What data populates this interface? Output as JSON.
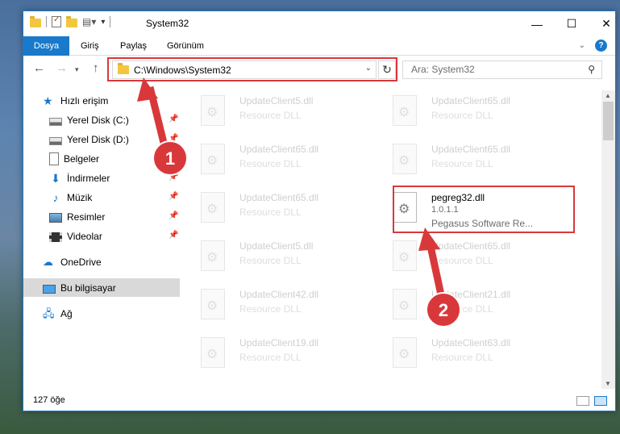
{
  "window": {
    "title": "System32"
  },
  "ribbon": {
    "tabs": [
      "Dosya",
      "Giriş",
      "Paylaş",
      "Görünüm"
    ],
    "help_label": "?"
  },
  "nav": {
    "address_path": "C:\\Windows\\System32",
    "search_placeholder": "Ara: System32"
  },
  "sidebar": {
    "items": [
      {
        "label": "Hızlı erişim",
        "icon": "star-icon"
      },
      {
        "label": "Yerel Disk (C:)",
        "icon": "drive-icon",
        "pinned": true
      },
      {
        "label": "Yerel Disk (D:)",
        "icon": "drive-icon",
        "pinned": true
      },
      {
        "label": "Belgeler",
        "icon": "document-icon",
        "pinned": true
      },
      {
        "label": "İndirmeler",
        "icon": "download-icon",
        "pinned": true
      },
      {
        "label": "Müzik",
        "icon": "music-icon",
        "pinned": true
      },
      {
        "label": "Resimler",
        "icon": "picture-icon",
        "pinned": true
      },
      {
        "label": "Videolar",
        "icon": "video-icon",
        "pinned": true
      },
      {
        "label": "OneDrive",
        "icon": "cloud-icon"
      },
      {
        "label": "Bu bilgisayar",
        "icon": "computer-icon",
        "selected": true
      },
      {
        "label": "Ağ",
        "icon": "network-icon"
      }
    ]
  },
  "files": [
    {
      "name": "UpdateClient5.dll",
      "desc": "Resource DLL"
    },
    {
      "name": "UpdateClient65.dll",
      "desc": "Resource DLL"
    },
    {
      "name": "UpdateClient65.dll",
      "desc": "Resource DLL"
    },
    {
      "name": "UpdateClient65.dll",
      "desc": "Resource DLL"
    },
    {
      "name": "UpdateClient65.dll",
      "desc": "Resource DLL"
    },
    {
      "name": "pegreg32.dll",
      "version": "1.0.1.1",
      "company": "Pegasus Software Re...",
      "active": true
    },
    {
      "name": "UpdateClient5.dll",
      "desc": "Resource DLL"
    },
    {
      "name": "UpdateClient65.dll",
      "desc": "Resource DLL"
    },
    {
      "name": "UpdateClient42.dll",
      "desc": "Resource DLL"
    },
    {
      "name": "UpdateClient21.dll",
      "desc": "Resource DLL"
    },
    {
      "name": "UpdateClient19.dll",
      "desc": "Resource DLL"
    },
    {
      "name": "UpdateClient63.dll",
      "desc": "Resource DLL"
    }
  ],
  "status": {
    "item_count": "127 öğe"
  },
  "annotations": {
    "badge1": "1",
    "badge2": "2",
    "color": "#d9383b"
  }
}
